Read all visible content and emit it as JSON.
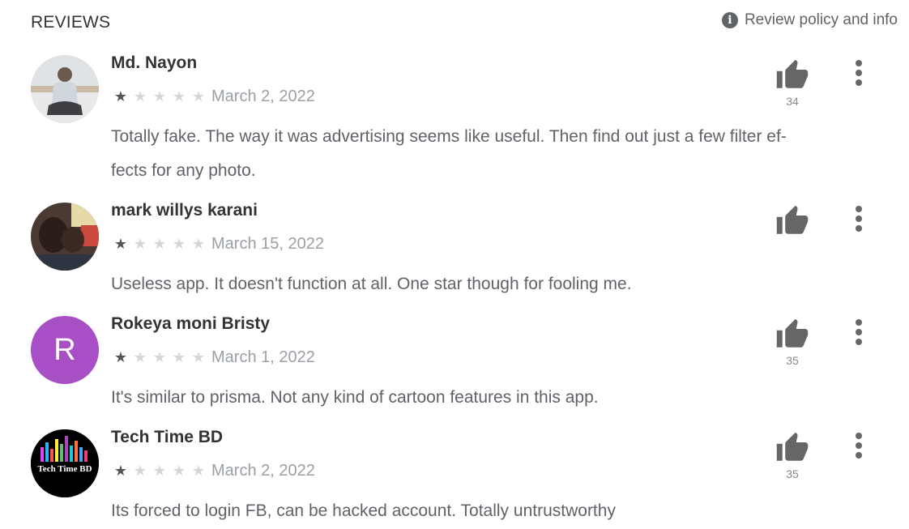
{
  "header": {
    "title": "REVIEWS",
    "policy_label": "Review policy and info",
    "policy_icon": "info-icon"
  },
  "colors": {
    "star_filled": "#555555",
    "star_empty": "#d6d6d6",
    "avatar_rokeya": "#a94fc5",
    "icon_gray": "#666666"
  },
  "reviews": [
    {
      "name": "Md. Nayon",
      "avatar_type": "photo",
      "rating": 1,
      "max_rating": 5,
      "date": "March 2, 2022",
      "text": "Totally fake. The way it was advertising seems like useful. Then find out just a few filter ef-fects for any photo.",
      "text_lines": [
        "Totally fake. The way it was advertising seems like useful. Then find out just a few filter ef-",
        "fects for any photo."
      ],
      "helpful_count": "34"
    },
    {
      "name": "mark willys karani",
      "avatar_type": "photo",
      "rating": 1,
      "max_rating": 5,
      "date": "March 15, 2022",
      "text": "Useless app. It doesn't function at all. One star though for fooling me.",
      "text_lines": [
        "Useless app. It doesn't function at all. One star though for fooling me."
      ],
      "helpful_count": ""
    },
    {
      "name": "Rokeya moni Bristy",
      "avatar_type": "letter",
      "avatar_letter": "R",
      "rating": 1,
      "max_rating": 5,
      "date": "March 1, 2022",
      "text": "It's similar to prisma. Not any kind of cartoon features in this app.",
      "text_lines": [
        "It's similar to prisma. Not any kind of cartoon features in this app."
      ],
      "helpful_count": "35"
    },
    {
      "name": "Tech Time BD",
      "avatar_type": "logo",
      "avatar_logo_text": "Tech Time BD",
      "rating": 1,
      "max_rating": 5,
      "date": "March 2, 2022",
      "text": "Its forced to login FB, can be hacked account. Totally untrustworthy",
      "text_lines": [
        "Its forced to login FB, can be hacked account. Totally untrustworthy"
      ],
      "helpful_count": "35"
    }
  ]
}
